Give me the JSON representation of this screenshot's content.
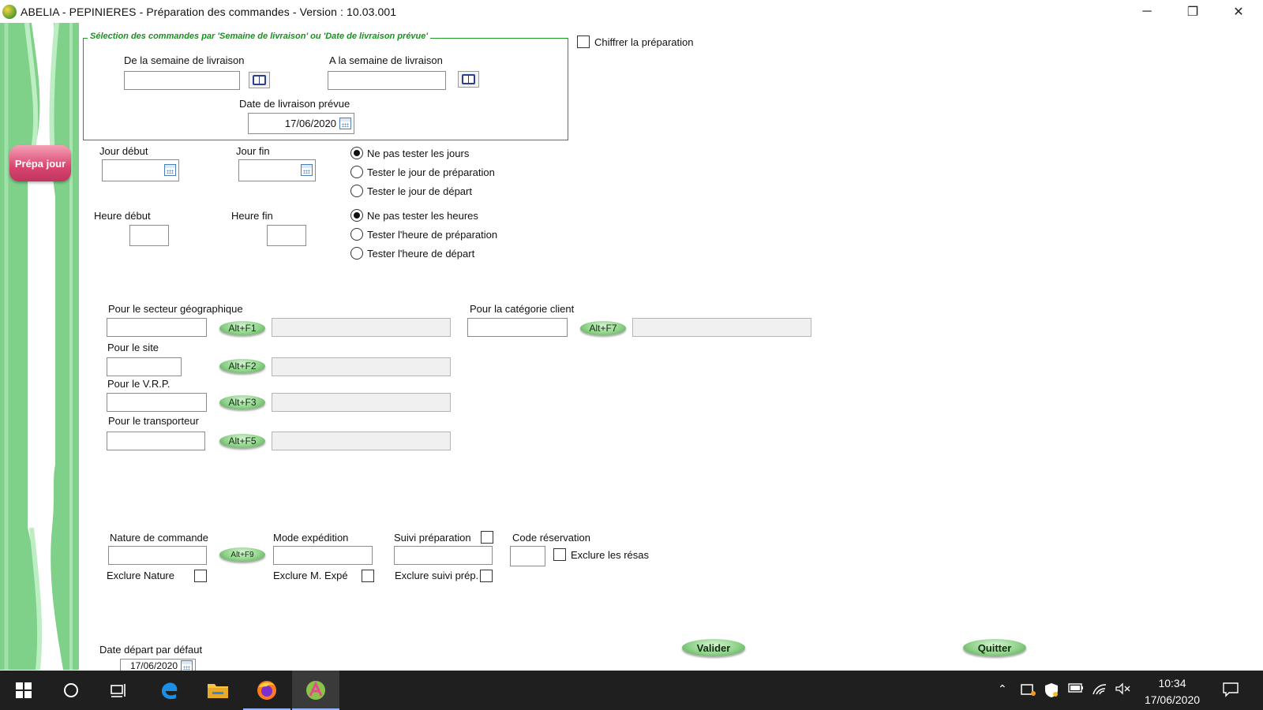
{
  "window": {
    "title": "ABELIA  -  PEPINIERES  -  Préparation des commandes   -  Version : 10.03.001",
    "minimize": "─",
    "restore": "❐",
    "close": "✕"
  },
  "side": {
    "prepa_button": "Prépa jour"
  },
  "selection": {
    "group_title": "Sélection des commandes par 'Semaine de livraison' ou 'Date de livraison prévue'",
    "from_week_label": "De la semaine de livraison",
    "to_week_label": "A la semaine de livraison",
    "from_week_value": "",
    "to_week_value": "",
    "planned_date_label": "Date de livraison prévue",
    "planned_date_value": "17/06/2020"
  },
  "chiffrer": {
    "label": "Chiffrer la préparation",
    "checked": false
  },
  "days": {
    "start_label": "Jour début",
    "end_label": "Jour fin",
    "options": [
      "Ne pas tester les jours",
      "Tester le jour de préparation",
      "Tester le jour de départ"
    ],
    "selected": 0
  },
  "hours": {
    "start_label": "Heure début",
    "end_label": "Heure fin",
    "options": [
      "Ne pas tester les heures",
      "Tester l'heure de préparation",
      "Tester l'heure de départ"
    ],
    "selected": 0
  },
  "filters": {
    "secteur_label": "Pour le secteur géographique",
    "site_label": "Pour le site",
    "vrp_label": "Pour le V.R.P.",
    "transporteur_label": "Pour le transporteur",
    "categorie_label": "Pour la catégorie client",
    "btn_f1": "Alt+F1",
    "btn_f2": "Alt+F2",
    "btn_f3": "Alt+F3",
    "btn_f5": "Alt+F5",
    "btn_f7": "Alt+F7"
  },
  "order": {
    "nature_label": "Nature de commande",
    "btn_f9": "Alt+F9",
    "mode_label": "Mode expédition",
    "suivi_label": "Suivi préparation",
    "code_label": "Code réservation",
    "exclure_resas_label": "Exclure les résas",
    "exclure_nature_label": "Exclure Nature",
    "exclure_mode_label": "Exclure M. Expé",
    "exclure_suivi_label": "Exclure suivi prép."
  },
  "footer": {
    "default_date_label": "Date départ par défaut",
    "default_date_value": "17/06/2020",
    "valider": "Valider",
    "quitter": "Quitter"
  },
  "taskbar": {
    "time": "10:34",
    "date": "17/06/2020"
  }
}
